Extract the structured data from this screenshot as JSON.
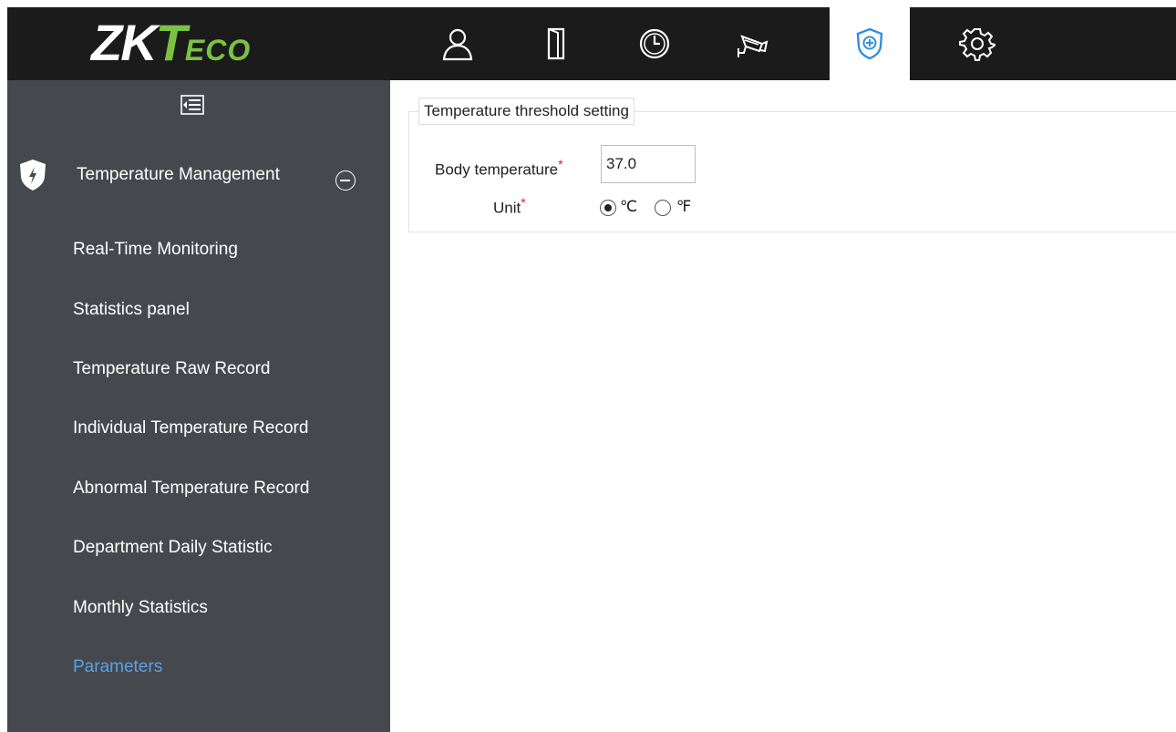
{
  "header": {
    "logo": {
      "z": "ZK",
      "t": "T",
      "eco": "ECO"
    },
    "nav_icons": [
      {
        "name": "personnel-icon"
      },
      {
        "name": "access-door-icon"
      },
      {
        "name": "attendance-clock-icon"
      },
      {
        "name": "video-camera-icon"
      },
      {
        "name": "temperature-shield-icon",
        "active": true
      },
      {
        "name": "system-gear-icon"
      }
    ]
  },
  "sidebar": {
    "collapse_icon": "menu-collapse-icon",
    "group": {
      "label": "Temperature Management",
      "icon": "shield-bolt-icon",
      "toggle_icon": "minus-circle-icon"
    },
    "items": [
      {
        "label": "Real-Time Monitoring"
      },
      {
        "label": "Statistics panel"
      },
      {
        "label": "Temperature Raw Record"
      },
      {
        "label": "Individual Temperature Record"
      },
      {
        "label": "Abnormal Temperature Record"
      },
      {
        "label": "Department Daily Statistic"
      },
      {
        "label": "Monthly Statistics"
      },
      {
        "label": "Parameters",
        "active": true
      }
    ]
  },
  "main": {
    "section_title": "Temperature threshold setting",
    "body_temperature": {
      "label": "Body temperature",
      "required": "*",
      "value": "37.0"
    },
    "unit": {
      "label": "Unit",
      "required": "*",
      "options": [
        {
          "label": "℃",
          "checked": true
        },
        {
          "label": "℉",
          "checked": false
        }
      ]
    }
  },
  "colors": {
    "topbar": "#1b1b1b",
    "sidebar": "#45494e",
    "active_link": "#5aa0e6",
    "required": "#e0201e",
    "brand_green": "#7cc242"
  }
}
